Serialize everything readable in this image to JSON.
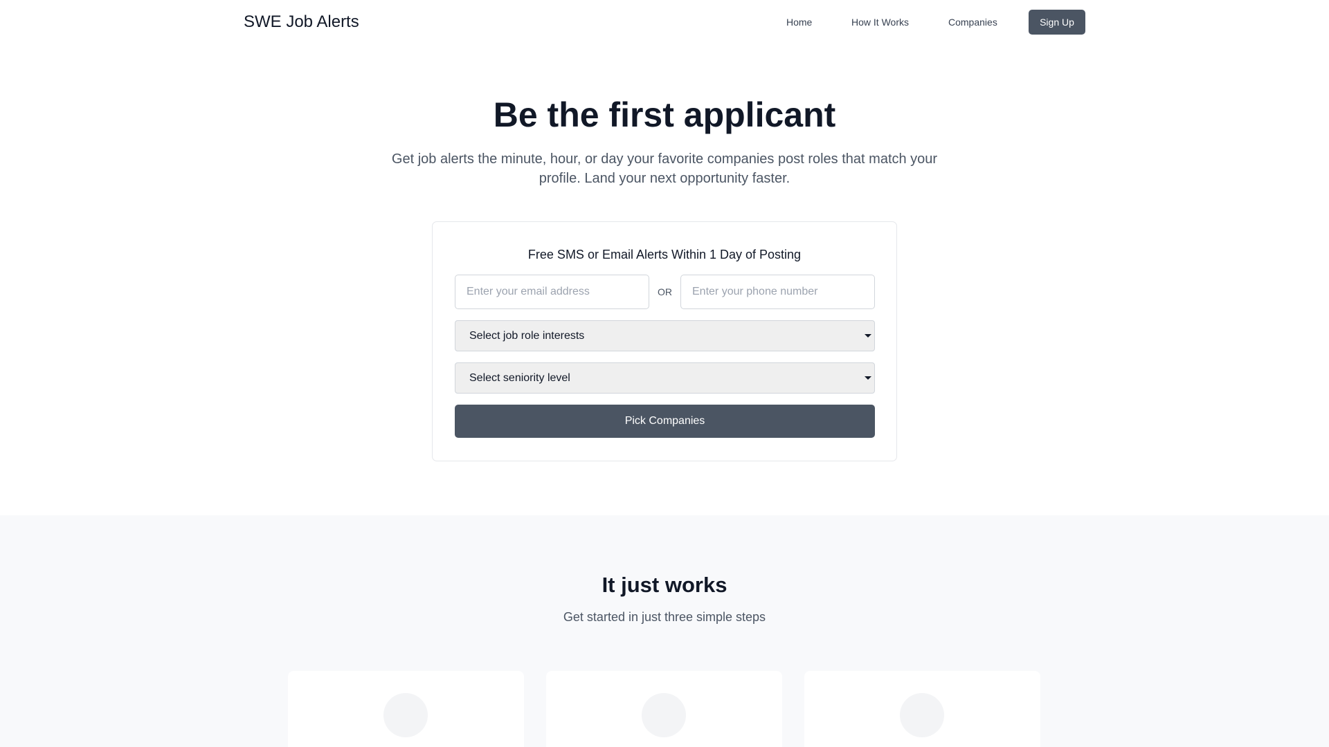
{
  "header": {
    "brand": "SWE Job Alerts",
    "nav": {
      "home": "Home",
      "how_it_works": "How It Works",
      "companies": "Companies"
    },
    "signup_label": "Sign Up"
  },
  "hero": {
    "title": "Be the first applicant",
    "subtitle": "Get job alerts the minute, hour, or day your favorite companies post roles that match your profile. Land your next opportunity faster."
  },
  "signup_card": {
    "title": "Free SMS or Email Alerts Within 1 Day of Posting",
    "email_placeholder": "Enter your email address",
    "or_label": "OR",
    "phone_placeholder": "Enter your phone number",
    "role_select": "Select job role interests",
    "seniority_select": "Select seniority level",
    "submit_label": "Pick Companies"
  },
  "how_it_works": {
    "title": "It just works",
    "subtitle": "Get started in just three simple steps"
  },
  "colors": {
    "primary_button": "#4b5563",
    "section_background": "#f8f9fb"
  }
}
